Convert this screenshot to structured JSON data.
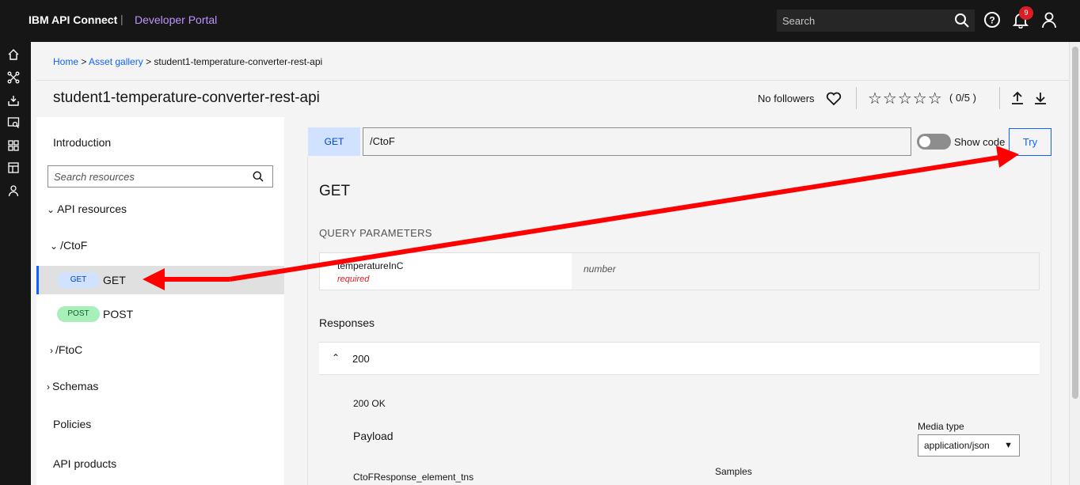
{
  "header": {
    "brand": "IBM API Connect",
    "separator": "|",
    "portal": "Developer Portal",
    "search_placeholder": "Search",
    "notification_count": "9"
  },
  "rail": {
    "icons": [
      "home-icon",
      "api-network-icon",
      "download-tray-icon",
      "search-list-icon",
      "apps-grid-icon",
      "dashboard-icon",
      "user-icon"
    ]
  },
  "breadcrumb": {
    "home": "Home",
    "sep1": " > ",
    "asset_gallery": "Asset gallery",
    "sep2": " > ",
    "current": "student1-temperature-converter-rest-api"
  },
  "title_row": {
    "title": "student1-temperature-converter-rest-api",
    "followers": "No followers",
    "stars": "☆☆☆☆☆",
    "rating": "( 0/5 )"
  },
  "sidebar": {
    "introduction": "Introduction",
    "search_placeholder": "Search resources",
    "api_resources": "API resources",
    "ctof": "/CtoF",
    "get_pill": "GET",
    "get_label": "GET",
    "post_pill": "POST",
    "post_label": "POST",
    "ftoc": "/FtoC",
    "schemas": "Schemas",
    "policies": "Policies",
    "api_products": "API products"
  },
  "operation": {
    "method": "GET",
    "path": "/CtoF",
    "show_code": "Show code",
    "try": "Try",
    "title": "GET",
    "query_params_heading": "QUERY PARAMETERS",
    "param_name": "temperatureInC",
    "param_required": "required",
    "param_type": "number",
    "responses_heading": "Responses",
    "response_code": "200",
    "response_desc": "200 OK",
    "payload": "Payload",
    "media_type_label": "Media type",
    "media_type_value": "application/json",
    "schema_name": "CtoFResponse_element_tns",
    "samples": "Samples"
  },
  "colors": {
    "topbar": "#161616",
    "accent": "#0f62fe",
    "portal_text": "#be95ff",
    "annotation_arrow": "#ff0000",
    "get_pill": "#d0e2ff",
    "post_pill": "#a7f0ba"
  }
}
